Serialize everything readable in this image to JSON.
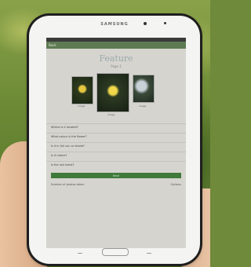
{
  "device": {
    "brand": "SAMSUNG"
  },
  "app": {
    "appbar_label": "Back",
    "title": "Feature",
    "subtitle": "Page 1",
    "photo_captions": [
      "image",
      "image",
      "image"
    ],
    "rows": [
      "Where is it located?",
      "What colour is the flower?",
      "Is it in full sun or shade?",
      "Is it native?",
      "Is the soil moist?"
    ],
    "primary_button": "Next",
    "footer_left": "Number of photos taken",
    "footer_right": "Options"
  },
  "colors": {
    "appbar": "#5e7a52",
    "primary_button": "#3f7a3a"
  }
}
